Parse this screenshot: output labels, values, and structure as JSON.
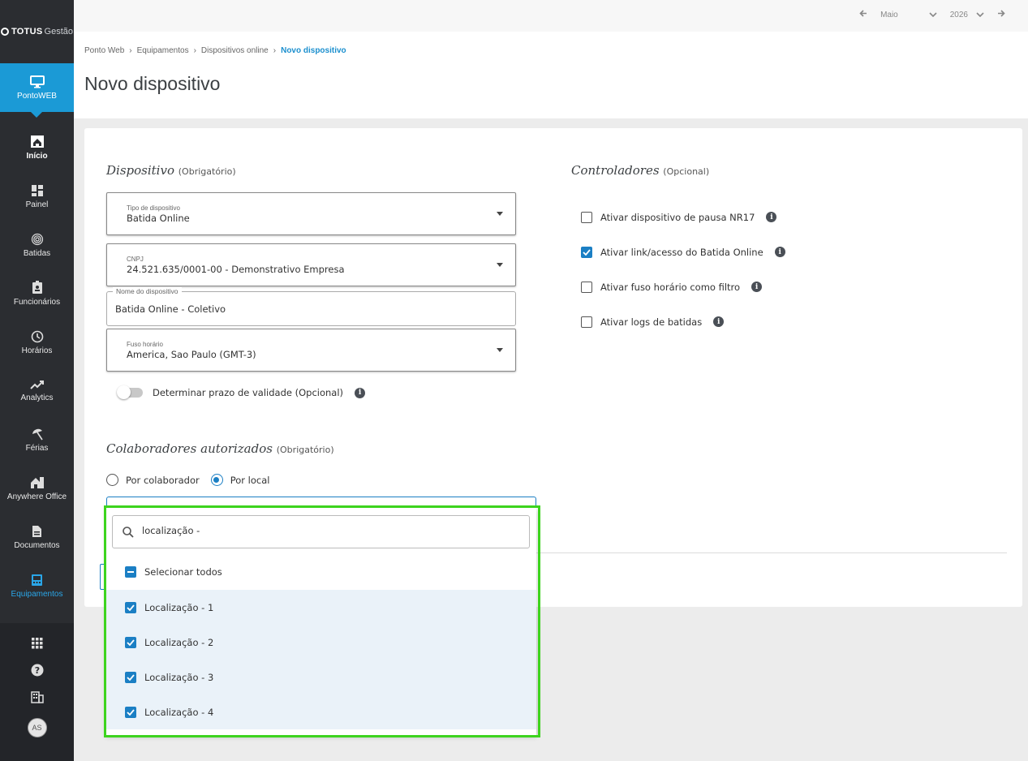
{
  "brand": {
    "name": "TOTUS",
    "suffix": "Gestão"
  },
  "product": {
    "label": "PontoWEB",
    "icon": "monitor-icon"
  },
  "nav": [
    {
      "label": "Início",
      "icon": "home-icon"
    },
    {
      "label": "Painel",
      "icon": "dashboard-icon"
    },
    {
      "label": "Batidas",
      "icon": "fingerprint-icon"
    },
    {
      "label": "Funcionários",
      "icon": "badge-icon"
    },
    {
      "label": "Horários",
      "icon": "clock-icon"
    },
    {
      "label": "Analytics",
      "icon": "trending-icon"
    },
    {
      "label": "Férias",
      "icon": "beach-umbrella-icon"
    },
    {
      "label": "Anywhere Office",
      "icon": "house-work-icon"
    },
    {
      "label": "Documentos",
      "icon": "document-icon"
    },
    {
      "label": "Equipamentos",
      "icon": "device-icon"
    }
  ],
  "sidebar_bottom": {
    "avatar": "AS"
  },
  "topbar": {
    "month": "Maio",
    "year": "2026"
  },
  "breadcrumb": [
    "Ponto Web",
    "Equipamentos",
    "Dispositivos online",
    "Novo dispositivo"
  ],
  "page": {
    "title": "Novo dispositivo"
  },
  "dispositivo": {
    "title": "Dispositivo",
    "tag": "(Obrigatório)",
    "tipo": {
      "label": "Tipo de dispositivo",
      "value": "Batida Online"
    },
    "cnpj": {
      "label": "CNPJ",
      "value": "24.521.635/0001-00 - Demonstrativo Empresa"
    },
    "nome": {
      "label": "Nome do dispositivo",
      "value": "Batida Online - Coletivo"
    },
    "fuso": {
      "label": "Fuso horário",
      "value": "America, Sao Paulo (GMT-3)"
    },
    "validade": {
      "label": "Determinar prazo de validade (Opcional)",
      "on": false
    }
  },
  "controladores": {
    "title": "Controladores",
    "tag": "(Opcional)",
    "items": [
      {
        "label": "Ativar dispositivo de pausa NR17",
        "checked": false
      },
      {
        "label": "Ativar link/acesso do Batida Online",
        "checked": true
      },
      {
        "label": "Ativar fuso horário como filtro",
        "checked": false
      },
      {
        "label": "Ativar logs de batidas",
        "checked": false
      }
    ]
  },
  "colaboradores": {
    "title": "Colaboradores autorizados",
    "tag": "(Obrigatório)",
    "radio_1": "Por colaborador",
    "radio_2": "Por local",
    "selected": "Por local"
  },
  "dropdown": {
    "search_value": "localização -",
    "select_all": "Selecionar todos",
    "options": [
      {
        "label": "Localização - 1",
        "checked": true
      },
      {
        "label": "Localização - 2",
        "checked": true
      },
      {
        "label": "Localização - 3",
        "checked": true
      },
      {
        "label": "Localização - 4",
        "checked": true
      }
    ]
  },
  "colors": {
    "accent": "#1b7fc4",
    "sidebar": "#2b2d31",
    "product": "#1b9ad6",
    "highlight": "#3dd41e"
  }
}
